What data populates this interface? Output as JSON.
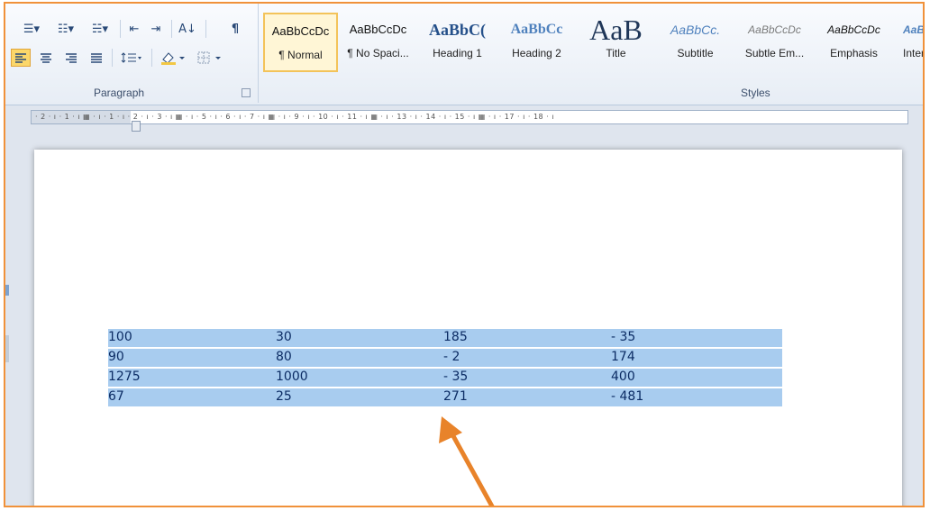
{
  "ribbon": {
    "paragraph_group_label": "Paragraph",
    "styles_group_label": "Styles",
    "paragraph_buttons": [
      {
        "name": "bullets-icon",
        "glyph": "☰▾"
      },
      {
        "name": "numbering-icon",
        "glyph": "☷▾"
      },
      {
        "name": "multilevel-list-icon",
        "glyph": "☵▾"
      },
      {
        "name": "decrease-indent-icon",
        "glyph": "⇤"
      },
      {
        "name": "increase-indent-icon",
        "glyph": "⇥"
      },
      {
        "name": "sort-icon",
        "glyph": "A↓"
      },
      {
        "name": "show-formatting-icon",
        "glyph": "¶"
      }
    ],
    "styles": [
      {
        "preview": "AaBbCcDc",
        "name": "¶ Normal"
      },
      {
        "preview": "AaBbCcDc",
        "name": "¶ No Spaci..."
      },
      {
        "preview": "AaBbC(",
        "name": "Heading 1"
      },
      {
        "preview": "AaBbCc",
        "name": "Heading 2"
      },
      {
        "preview": "AaB",
        "name": "Title"
      },
      {
        "preview": "AaBbCc.",
        "name": "Subtitle"
      },
      {
        "preview": "AaBbCcDc",
        "name": "Subtle Em..."
      },
      {
        "preview": "AaBbCcDc",
        "name": "Emphasis"
      },
      {
        "preview": "AaB",
        "name": "Inter"
      }
    ]
  },
  "ruler": {
    "text": "· 2 · ı · 1 · ı ▦ · ı · 1 · ı · 2 · ı · 3 · ı ▦ · ı · 5 · ı · 6 · ı · 7 · ı ▦ · ı · 9 · ı · 10 · ı · 11 · ı ▦ · ı · 13 · ı · 14 · ı · 15 · ı ▦ · ı · 17 · ı · 18 · ı"
  },
  "table": {
    "rows": [
      [
        "100",
        "30",
        "185",
        "- 35"
      ],
      [
        "90",
        "80",
        "- 2",
        "174"
      ],
      [
        "1275",
        "1000",
        "- 35",
        "400"
      ],
      [
        "67",
        "25",
        "271",
        "- 481"
      ]
    ]
  },
  "colors": {
    "highlight": "#a8ccef",
    "annotation": "#e8832a",
    "border": "#f0913a"
  }
}
